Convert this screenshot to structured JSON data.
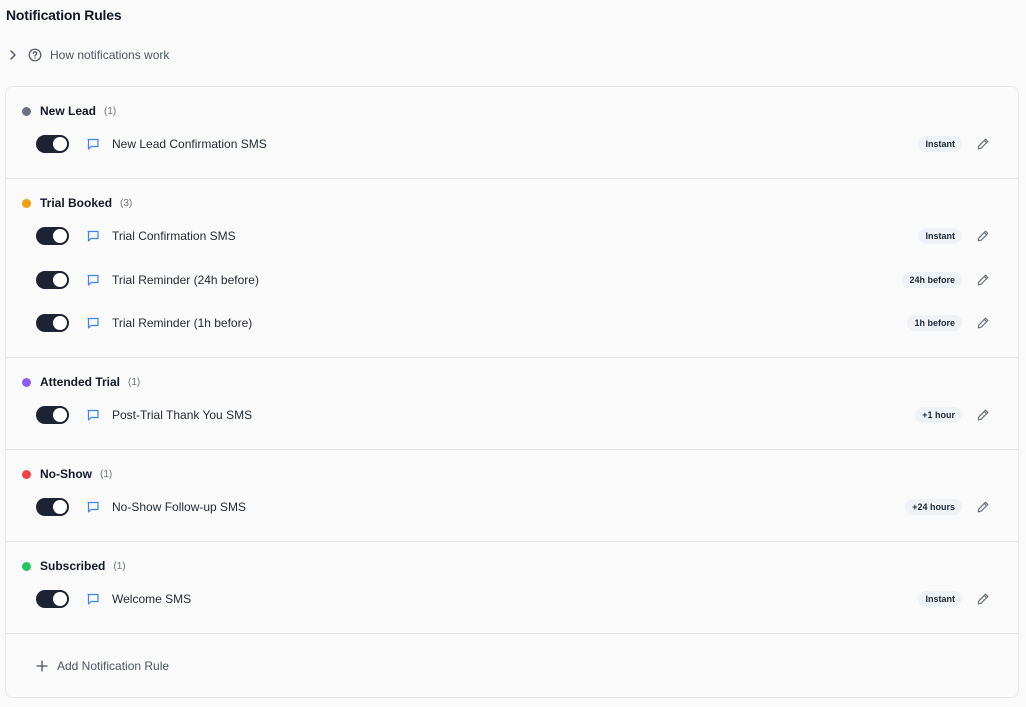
{
  "page_title": "Notification Rules",
  "help": {
    "label": "How notifications work",
    "icons": [
      "chevron-right-icon",
      "help-circle-icon"
    ]
  },
  "colors": {
    "new_lead": "#6b7280",
    "trial_booked": "#f59e0b",
    "attended_trial": "#8b5cf6",
    "no_show": "#ef4444",
    "subscribed": "#22c55e",
    "toggle_on": "#1e2333",
    "message_icon": "#3b82f6"
  },
  "groups": [
    {
      "name": "New Lead",
      "count": "(1)",
      "rules": [
        {
          "name": "New Lead Confirmation SMS",
          "timing": "Instant",
          "enabled": true
        }
      ]
    },
    {
      "name": "Trial Booked",
      "count": "(3)",
      "rules": [
        {
          "name": "Trial Confirmation SMS",
          "timing": "Instant",
          "enabled": true
        },
        {
          "name": "Trial Reminder (24h before)",
          "timing": "24h before",
          "enabled": true
        },
        {
          "name": "Trial Reminder (1h before)",
          "timing": "1h before",
          "enabled": true
        }
      ]
    },
    {
      "name": "Attended Trial",
      "count": "(1)",
      "rules": [
        {
          "name": "Post-Trial Thank You SMS",
          "timing": "+1 hour",
          "enabled": true
        }
      ]
    },
    {
      "name": "No-Show",
      "count": "(1)",
      "rules": [
        {
          "name": "No-Show Follow-up SMS",
          "timing": "+24 hours",
          "enabled": true
        }
      ]
    },
    {
      "name": "Subscribed",
      "count": "(1)",
      "rules": [
        {
          "name": "Welcome SMS",
          "timing": "Instant",
          "enabled": true
        }
      ]
    }
  ],
  "add_rule": {
    "label": "Add Notification Rule",
    "icon": "plus-icon"
  }
}
